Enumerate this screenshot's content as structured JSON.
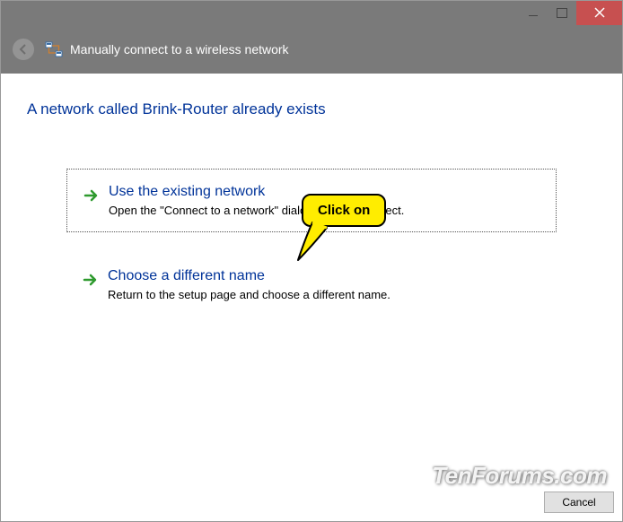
{
  "titlebar": {
    "minimize": "Minimize",
    "maximize": "Maximize",
    "close": "Close"
  },
  "header": {
    "title": "Manually connect to a wireless network"
  },
  "main": {
    "heading": "A network called Brink-Router already exists",
    "options": [
      {
        "title": "Use the existing network",
        "desc": "Open the \"Connect to a network\" dialog so I can connect."
      },
      {
        "title": "Choose a different name",
        "desc": "Return to the setup page and choose a different name."
      }
    ]
  },
  "callout": {
    "text": "Click on"
  },
  "footer": {
    "cancel": "Cancel"
  },
  "watermark": "TenForums.com"
}
